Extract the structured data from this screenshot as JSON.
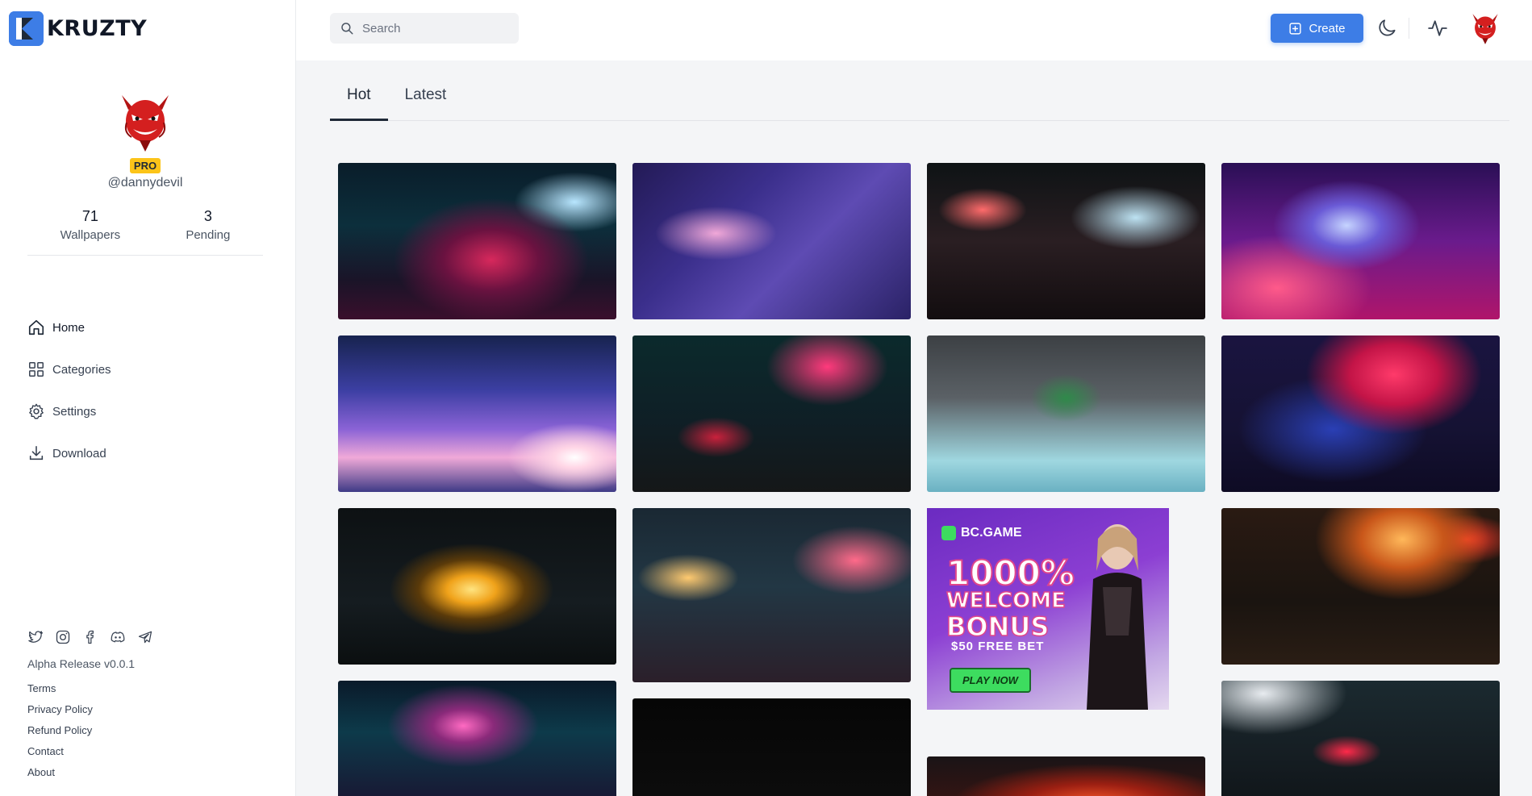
{
  "app": {
    "name": "KRUZTY"
  },
  "profile": {
    "badge": "PRO",
    "handle": "@dannydevil",
    "stats": [
      {
        "value": "71",
        "label": "Wallpapers"
      },
      {
        "value": "3",
        "label": "Pending"
      }
    ]
  },
  "nav": {
    "items": [
      {
        "label": "Home",
        "icon": "home-icon",
        "active": true
      },
      {
        "label": "Categories",
        "icon": "grid-icon"
      },
      {
        "label": "Settings",
        "icon": "gear-icon"
      },
      {
        "label": "Download",
        "icon": "download-icon"
      }
    ]
  },
  "footer": {
    "socials": [
      "twitter-icon",
      "instagram-icon",
      "facebook-icon",
      "discord-icon",
      "telegram-icon"
    ],
    "release": "Alpha Release v0.0.1",
    "links": [
      "Terms",
      "Privacy Policy",
      "Refund Policy",
      "Contact",
      "About"
    ]
  },
  "topbar": {
    "search_placeholder": "Search",
    "create_label": "Create"
  },
  "tabs": [
    {
      "label": "Hot",
      "active": true
    },
    {
      "label": "Latest"
    }
  ],
  "ad": {
    "brand": "BC.GAME",
    "headline": "1000%",
    "line2": "WELCOME",
    "line3": "BONUS",
    "offer": "$50 FREE BET",
    "cta": "PLAY NOW"
  },
  "colors": {
    "accent": "#3d7de6",
    "pro_badge": "#fcc419",
    "background": "#f4f5f7"
  }
}
